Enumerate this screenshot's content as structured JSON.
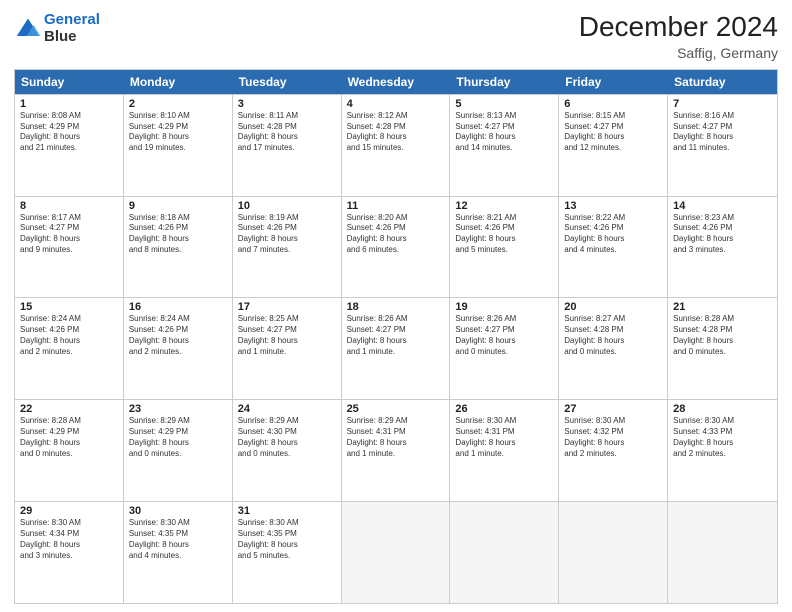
{
  "header": {
    "logo": {
      "line1": "General",
      "line2": "Blue"
    },
    "title": "December 2024",
    "subtitle": "Saffig, Germany"
  },
  "dayHeaders": [
    "Sunday",
    "Monday",
    "Tuesday",
    "Wednesday",
    "Thursday",
    "Friday",
    "Saturday"
  ],
  "weeks": [
    [
      {
        "day": 1,
        "info": "Sunrise: 8:08 AM\nSunset: 4:29 PM\nDaylight: 8 hours\nand 21 minutes."
      },
      {
        "day": 2,
        "info": "Sunrise: 8:10 AM\nSunset: 4:29 PM\nDaylight: 8 hours\nand 19 minutes."
      },
      {
        "day": 3,
        "info": "Sunrise: 8:11 AM\nSunset: 4:28 PM\nDaylight: 8 hours\nand 17 minutes."
      },
      {
        "day": 4,
        "info": "Sunrise: 8:12 AM\nSunset: 4:28 PM\nDaylight: 8 hours\nand 15 minutes."
      },
      {
        "day": 5,
        "info": "Sunrise: 8:13 AM\nSunset: 4:27 PM\nDaylight: 8 hours\nand 14 minutes."
      },
      {
        "day": 6,
        "info": "Sunrise: 8:15 AM\nSunset: 4:27 PM\nDaylight: 8 hours\nand 12 minutes."
      },
      {
        "day": 7,
        "info": "Sunrise: 8:16 AM\nSunset: 4:27 PM\nDaylight: 8 hours\nand 11 minutes."
      }
    ],
    [
      {
        "day": 8,
        "info": "Sunrise: 8:17 AM\nSunset: 4:27 PM\nDaylight: 8 hours\nand 9 minutes."
      },
      {
        "day": 9,
        "info": "Sunrise: 8:18 AM\nSunset: 4:26 PM\nDaylight: 8 hours\nand 8 minutes."
      },
      {
        "day": 10,
        "info": "Sunrise: 8:19 AM\nSunset: 4:26 PM\nDaylight: 8 hours\nand 7 minutes."
      },
      {
        "day": 11,
        "info": "Sunrise: 8:20 AM\nSunset: 4:26 PM\nDaylight: 8 hours\nand 6 minutes."
      },
      {
        "day": 12,
        "info": "Sunrise: 8:21 AM\nSunset: 4:26 PM\nDaylight: 8 hours\nand 5 minutes."
      },
      {
        "day": 13,
        "info": "Sunrise: 8:22 AM\nSunset: 4:26 PM\nDaylight: 8 hours\nand 4 minutes."
      },
      {
        "day": 14,
        "info": "Sunrise: 8:23 AM\nSunset: 4:26 PM\nDaylight: 8 hours\nand 3 minutes."
      }
    ],
    [
      {
        "day": 15,
        "info": "Sunrise: 8:24 AM\nSunset: 4:26 PM\nDaylight: 8 hours\nand 2 minutes."
      },
      {
        "day": 16,
        "info": "Sunrise: 8:24 AM\nSunset: 4:26 PM\nDaylight: 8 hours\nand 2 minutes."
      },
      {
        "day": 17,
        "info": "Sunrise: 8:25 AM\nSunset: 4:27 PM\nDaylight: 8 hours\nand 1 minute."
      },
      {
        "day": 18,
        "info": "Sunrise: 8:26 AM\nSunset: 4:27 PM\nDaylight: 8 hours\nand 1 minute."
      },
      {
        "day": 19,
        "info": "Sunrise: 8:26 AM\nSunset: 4:27 PM\nDaylight: 8 hours\nand 0 minutes."
      },
      {
        "day": 20,
        "info": "Sunrise: 8:27 AM\nSunset: 4:28 PM\nDaylight: 8 hours\nand 0 minutes."
      },
      {
        "day": 21,
        "info": "Sunrise: 8:28 AM\nSunset: 4:28 PM\nDaylight: 8 hours\nand 0 minutes."
      }
    ],
    [
      {
        "day": 22,
        "info": "Sunrise: 8:28 AM\nSunset: 4:29 PM\nDaylight: 8 hours\nand 0 minutes."
      },
      {
        "day": 23,
        "info": "Sunrise: 8:29 AM\nSunset: 4:29 PM\nDaylight: 8 hours\nand 0 minutes."
      },
      {
        "day": 24,
        "info": "Sunrise: 8:29 AM\nSunset: 4:30 PM\nDaylight: 8 hours\nand 0 minutes."
      },
      {
        "day": 25,
        "info": "Sunrise: 8:29 AM\nSunset: 4:31 PM\nDaylight: 8 hours\nand 1 minute."
      },
      {
        "day": 26,
        "info": "Sunrise: 8:30 AM\nSunset: 4:31 PM\nDaylight: 8 hours\nand 1 minute."
      },
      {
        "day": 27,
        "info": "Sunrise: 8:30 AM\nSunset: 4:32 PM\nDaylight: 8 hours\nand 2 minutes."
      },
      {
        "day": 28,
        "info": "Sunrise: 8:30 AM\nSunset: 4:33 PM\nDaylight: 8 hours\nand 2 minutes."
      }
    ],
    [
      {
        "day": 29,
        "info": "Sunrise: 8:30 AM\nSunset: 4:34 PM\nDaylight: 8 hours\nand 3 minutes."
      },
      {
        "day": 30,
        "info": "Sunrise: 8:30 AM\nSunset: 4:35 PM\nDaylight: 8 hours\nand 4 minutes."
      },
      {
        "day": 31,
        "info": "Sunrise: 8:30 AM\nSunset: 4:35 PM\nDaylight: 8 hours\nand 5 minutes."
      },
      {
        "day": null
      },
      {
        "day": null
      },
      {
        "day": null
      },
      {
        "day": null
      }
    ]
  ]
}
